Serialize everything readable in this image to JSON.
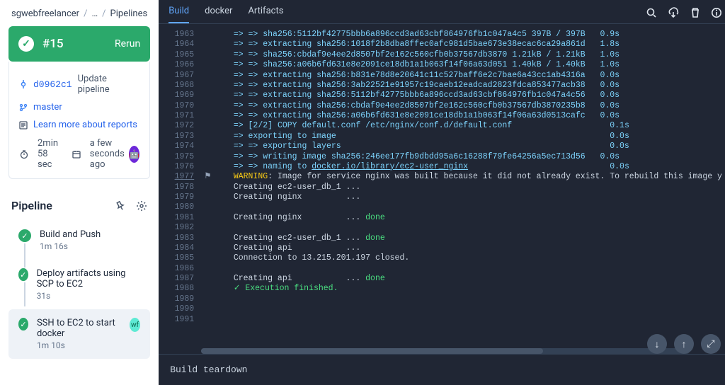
{
  "breadcrumbs": {
    "root": "sgwebfreelancer",
    "mid": "…",
    "leaf": "Pipelines"
  },
  "run": {
    "id": "#15",
    "rerun": "Rerun"
  },
  "info": {
    "commit": "d0962c1",
    "commit_msg": "Update pipeline",
    "branch": "master",
    "reports": "Learn more about reports",
    "duration": "2min 58 sec",
    "when": "a few seconds ago"
  },
  "section": {
    "title": "Pipeline"
  },
  "steps": [
    {
      "title": "Build and Push",
      "sub": "1m 16s"
    },
    {
      "title": "Deploy artifacts using SCP to EC2",
      "sub": "31s"
    },
    {
      "title": "SSH to EC2 to start docker",
      "sub": "1m 10s",
      "badge": "wf"
    }
  ],
  "tabs": {
    "build": "Build",
    "docker": "docker",
    "artifacts": "Artifacts"
  },
  "teardown": "Build teardown",
  "log": [
    {
      "n": 1963,
      "html": "<span class='arr'>=&gt; =&gt;</span> <span class='sha'>sha256:5112bf42775bbb6a896ccd3ad63cbf864976fb1c047a4c5 397B / 397B</span>   <span class='timing'>0.9s</span>"
    },
    {
      "n": 1964,
      "html": "<span class='arr'>=&gt; =&gt;</span> <span class='sha'>extracting sha256:1018f2b8dba8ffec0afc981d5bae673e38ecac6ca29a861d</span>   <span class='timing'>1.8s</span>"
    },
    {
      "n": 1965,
      "html": "<span class='arr'>=&gt; =&gt;</span> <span class='sha'>sha256:cbdaf9e4ee2d8507bf2e162c560cfb0b37567db3870 1.21kB / 1.21kB</span>   <span class='timing'>1.0s</span>"
    },
    {
      "n": 1966,
      "html": "<span class='arr'>=&gt; =&gt;</span> <span class='sha'>sha256:a06b6fd631e8e2091ce18db1a1b063f14f06a63d051 1.40kB / 1.40kB</span>   <span class='timing'>1.0s</span>"
    },
    {
      "n": 1967,
      "html": "<span class='arr'>=&gt; =&gt;</span> <span class='sha'>extracting sha256:b831e78d8e20641c11c527baff6e2c7bae6a43cc1ab4316a</span>   <span class='timing'>0.0s</span>"
    },
    {
      "n": 1968,
      "html": "<span class='arr'>=&gt; =&gt;</span> <span class='sha'>extracting sha256:3ab22521e91957c19caeb12eadcad2823fdca853477acb38</span>   <span class='timing'>0.0s</span>"
    },
    {
      "n": 1969,
      "html": "<span class='arr'>=&gt; =&gt;</span> <span class='sha'>extracting sha256:5112bf42775bbb6a896ccd3ad63cbf864976fb1c047a4c56</span>   <span class='timing'>0.0s</span>"
    },
    {
      "n": 1970,
      "html": "<span class='arr'>=&gt; =&gt;</span> <span class='sha'>extracting sha256:cbdaf9e4ee2d8507bf2e162c560cfb0b37567db3870235b8</span>   <span class='timing'>0.0s</span>"
    },
    {
      "n": 1971,
      "html": "<span class='arr'>=&gt; =&gt;</span> <span class='sha'>extracting sha256:a06b6fd631e8e2091ce18db1a1b063f14f06a63d0513cafc</span>   <span class='timing'>0.0s</span>"
    },
    {
      "n": 1972,
      "html": "<span class='arr'>=&gt;</span> <span class='cmd'>[2/2] COPY default.conf /etc/nginx/conf.d/default.conf</span>                    <span class='timing'>0.1s</span>"
    },
    {
      "n": 1973,
      "html": "<span class='arr'>=&gt;</span> <span class='cmd'>exporting to image</span>                                                        <span class='timing'>0.0s</span>"
    },
    {
      "n": 1974,
      "html": "<span class='arr'>=&gt; =&gt;</span> <span class='cmd'>exporting layers</span>                                                       <span class='timing'>0.0s</span>"
    },
    {
      "n": 1975,
      "html": "<span class='arr'>=&gt; =&gt;</span> <span class='cmd'>writing image sha256:246ee177fb9dbdd95a6c16288f79fe64256a5ec713d56</span>   <span class='timing'>0.0s</span>"
    },
    {
      "n": 1976,
      "html": "<span class='arr'>=&gt; =&gt;</span> <span class='cmd'>naming to </span><span class='link-u'>docker.io/library/ec2-user_nginx</span>                             <span class='timing'>0.0s</span>"
    },
    {
      "n": 1977,
      "flag": "⚑",
      "active": true,
      "html": "<span class='warn'>WARNING</span><span class='plain'>: Image for service nginx was built because it did not already exist. To rebuild this image y</span>"
    },
    {
      "n": 1978,
      "html": "<span class='plain'>Creating ec2-user_db_1 ...</span>"
    },
    {
      "n": 1979,
      "html": "<span class='plain'>Creating nginx         ...</span>"
    },
    {
      "n": 1980,
      "html": "<span class='plain'> </span>"
    },
    {
      "n": 1981,
      "html": "<span class='plain'>Creating nginx         ... </span><span class='done'>done</span>"
    },
    {
      "n": 1982,
      "html": "<span class='plain'> </span>"
    },
    {
      "n": 1983,
      "html": "<span class='plain'>Creating ec2-user_db_1 ... </span><span class='done'>done</span>"
    },
    {
      "n": 1984,
      "html": "<span class='plain'>Creating api           ...</span>"
    },
    {
      "n": 1985,
      "html": "<span class='plain'>Connection to 13.215.201.197 closed.</span>"
    },
    {
      "n": 1986,
      "html": "<span class='plain'> </span>"
    },
    {
      "n": 1987,
      "html": "<span class='plain'>Creating api           ... </span><span class='done'>done</span>"
    },
    {
      "n": 1988,
      "html": "<span class='done'>✓ Execution finished.</span>"
    },
    {
      "n": 1989,
      "html": "<span class='plain'> </span>"
    },
    {
      "n": 1990,
      "html": "<span class='plain'> </span>"
    },
    {
      "n": 1991,
      "html": "<span class='plain'> </span>"
    }
  ]
}
